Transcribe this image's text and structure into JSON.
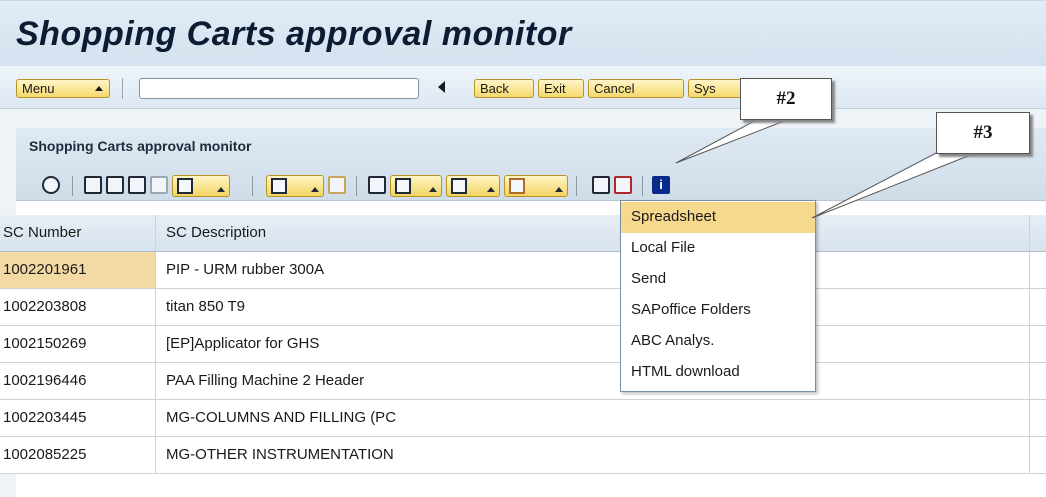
{
  "window": {
    "title": "Shopping Carts approval monitor"
  },
  "toolbar": {
    "menu_label": "Menu",
    "command_field_value": "",
    "buttons": [
      {
        "label": "Back"
      },
      {
        "label": "Exit"
      },
      {
        "label": "Cancel"
      },
      {
        "label": "Sys"
      }
    ]
  },
  "panel": {
    "title": "Shopping Carts approval monitor",
    "alv_toolbar_icons": [
      "details-icon",
      "print-icon",
      "save-layout-icon",
      "find-icon",
      "find-next-icon",
      "filter-icon",
      "sum-icon",
      "subtotal-icon",
      "print-preview-icon",
      "views-icon",
      "export-icon",
      "layout-icon",
      "column-icon",
      "graphic-icon",
      "info-icon"
    ]
  },
  "table": {
    "columns": [
      "SC Number",
      "SC Description"
    ],
    "rows": [
      [
        "1002201961",
        "PIP - URM rubber 300A"
      ],
      [
        "1002203808",
        "titan 850 T9"
      ],
      [
        "1002150269",
        "[EP]Applicator for GHS"
      ],
      [
        "1002196446",
        "PAA Filling Machine 2 Header"
      ],
      [
        "1002203445",
        "MG-COLUMNS AND FILLING (PC"
      ],
      [
        "1002085225",
        "MG-OTHER INSTRUMENTATION"
      ]
    ]
  },
  "export_menu": {
    "items": [
      {
        "label": "Spreadsheet"
      },
      {
        "label": "Local File"
      },
      {
        "label": "Send"
      },
      {
        "label": "SAPoffice Folders"
      },
      {
        "label": "ABC Analys."
      },
      {
        "label": "HTML download"
      }
    ]
  },
  "callouts": [
    "#2",
    "#3"
  ],
  "colors": {
    "highlight": "#f6d98d",
    "selected_cell": "#f3d9a4",
    "button_fill": "#f5d96c"
  }
}
